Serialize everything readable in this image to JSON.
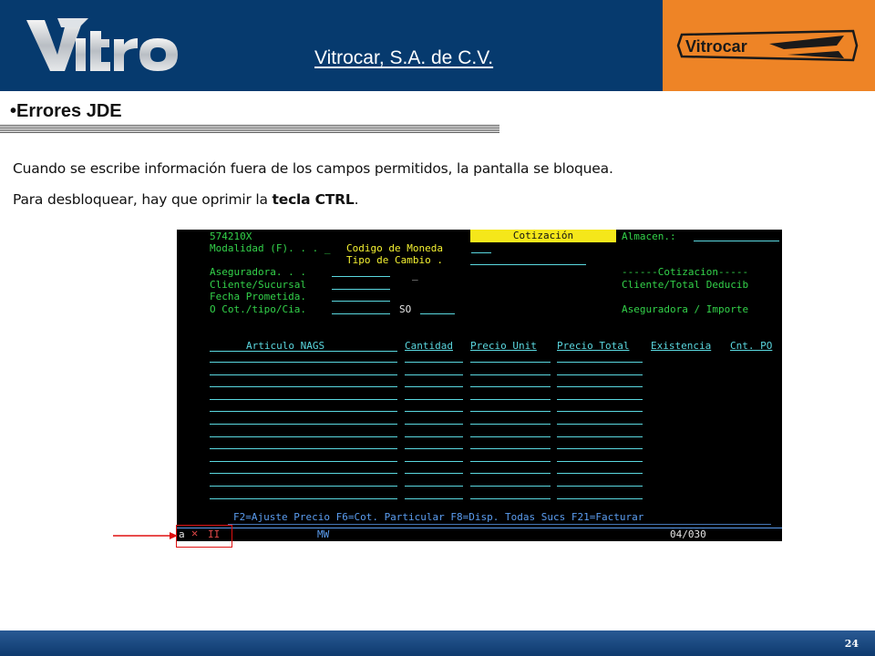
{
  "header": {
    "logo_text": "Vitro",
    "company": "Vitrocar, S.A. de C.V.",
    "brand_logo_text": "Vitrocar"
  },
  "slide": {
    "title": "•Errores JDE",
    "para1": "Cuando se escribe información fuera de los campos permitidos, la pantalla se bloquea.",
    "para2_prefix": "Para desbloquear, hay que oprimir la ",
    "para2_bold": "tecla CTRL",
    "para2_suffix": "."
  },
  "terminal": {
    "program": "574210X",
    "screen_title": "Cotización",
    "almacen_label": "Almacen.:",
    "modalidad_label": "Modalidad (F). . . _",
    "codigo_moneda_label": "Codigo de Moneda",
    "tipo_cambio_label": "Tipo de Cambio .",
    "aseguradora_label": "Aseguradora. . .",
    "cliente_sucursal_label": "Cliente/Sucursal",
    "fecha_prometida_label": "Fecha Prometida.",
    "o_cot_label": "O Cot./tipo/Cia.",
    "so_value": "SO",
    "cursor": "_",
    "cotizacion_section": "------Cotizacion-----",
    "cliente_total_label": "Cliente/Total Deducib",
    "aseguradora_importe_label": "Aseguradora / Importe",
    "columns": {
      "articulo": "Articulo NAGS",
      "cantidad": "Cantidad",
      "precio_unit": "Precio Unit",
      "precio_total": "Precio Total",
      "existencia": "Existencia",
      "cnt_po": "Cnt. PO"
    },
    "function_keys": "F2=Ajuste Precio F6=Cot. Particular F8=Disp. Todas Sucs F21=Facturar",
    "status": {
      "indicator_a": "a",
      "indicator_x": "✕",
      "indicator_ii": "II",
      "mw": "MW",
      "position": "04/030"
    }
  },
  "footer": {
    "page_number": "24"
  },
  "colors": {
    "header_blue": "#063a6e",
    "header_orange": "#ee8426",
    "terminal_green": "#33d24a",
    "terminal_cyan": "#5ad8e0",
    "terminal_yellow": "#f5e71a",
    "highlight_red": "#e01010"
  }
}
